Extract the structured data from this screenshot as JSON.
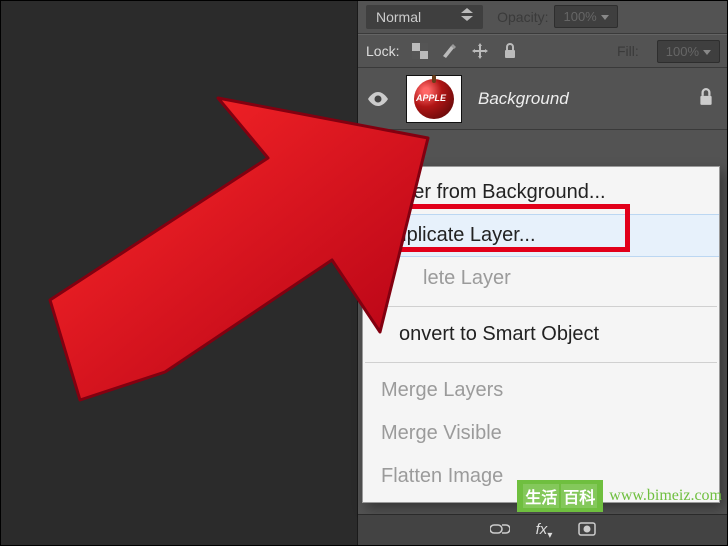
{
  "panel": {
    "blend_mode": "Normal",
    "opacity_label": "Opacity:",
    "opacity_value": "100%",
    "lock_label": "Lock:",
    "fill_label": "Fill:",
    "fill_value": "100%"
  },
  "layer": {
    "name": "Background",
    "thumb_text": "APPLE"
  },
  "menu": {
    "layer_from_bg": "Layer from Background...",
    "duplicate": "Duplicate Layer...",
    "delete_layer": "Delete Layer",
    "delete_layer_partial": "lete Layer",
    "convert_smart": "Convert to Smart Object",
    "convert_smart_partial": "onvert to Smart Object",
    "merge_layers": "Merge Layers",
    "merge_visible": "Merge Visible",
    "flatten": "Flatten Image"
  },
  "watermark": {
    "badge1": "生活",
    "badge2": "百科",
    "url": "www.bimeiz.com"
  }
}
